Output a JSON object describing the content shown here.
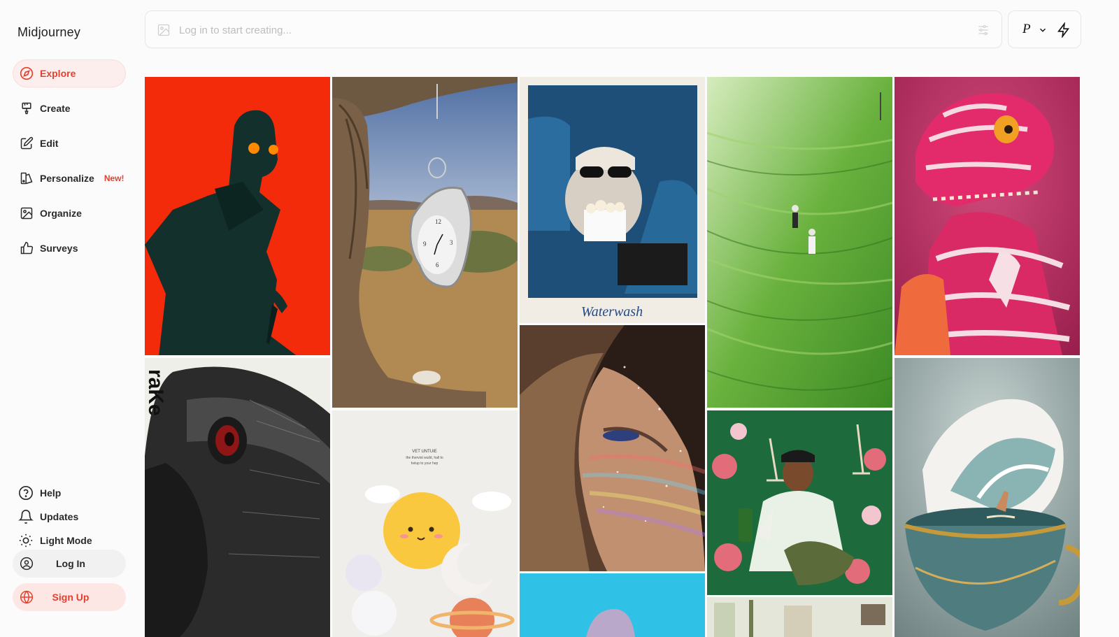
{
  "app": {
    "title": "Midjourney"
  },
  "sidebar": {
    "items": [
      {
        "label": "Explore",
        "icon": "compass-icon",
        "active": true
      },
      {
        "label": "Create",
        "icon": "brush-icon"
      },
      {
        "label": "Edit",
        "icon": "edit-icon"
      },
      {
        "label": "Personalize",
        "icon": "personalize-icon",
        "badge": "New!"
      },
      {
        "label": "Organize",
        "icon": "image-icon"
      },
      {
        "label": "Surveys",
        "icon": "thumbs-up-icon"
      }
    ],
    "bottom": [
      {
        "label": "Help",
        "icon": "help-icon"
      },
      {
        "label": "Updates",
        "icon": "bell-icon"
      },
      {
        "label": "Light Mode",
        "icon": "sun-icon"
      }
    ],
    "login_label": "Log In",
    "signup_label": "Sign Up"
  },
  "search": {
    "placeholder": "Log in to start creating..."
  },
  "tools": {
    "personalize_label": "P"
  },
  "gallery": {
    "captions": {
      "polaroid": "Waterwash",
      "rabbit_text": "raKe",
      "planets_text": "VET UNTUIE\nthe thervist wuild, hall to\nhelup to your hep"
    }
  },
  "colors": {
    "accent": "#e3412e",
    "active_bg": "#fdeeee"
  }
}
